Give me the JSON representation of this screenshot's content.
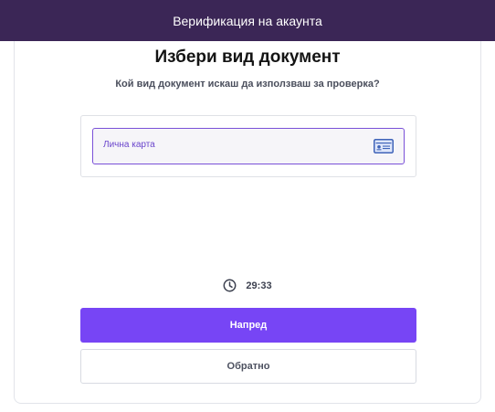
{
  "header": {
    "title": "Верификация на акаунта"
  },
  "main": {
    "title": "Избери вид документ",
    "subtitle": "Кой вид документ искаш да използваш за проверка?",
    "options": [
      {
        "label": "Лична карта",
        "icon": "id-card-icon",
        "selected": true
      }
    ],
    "timer": {
      "icon": "clock-icon",
      "value": "29:33"
    },
    "buttons": {
      "next_label": "Напред",
      "back_label": "Обратно"
    }
  },
  "colors": {
    "header_bg": "#3b2656",
    "accent": "#7745f5",
    "option_border": "#7a50d8",
    "option_text": "#6a45cc"
  }
}
